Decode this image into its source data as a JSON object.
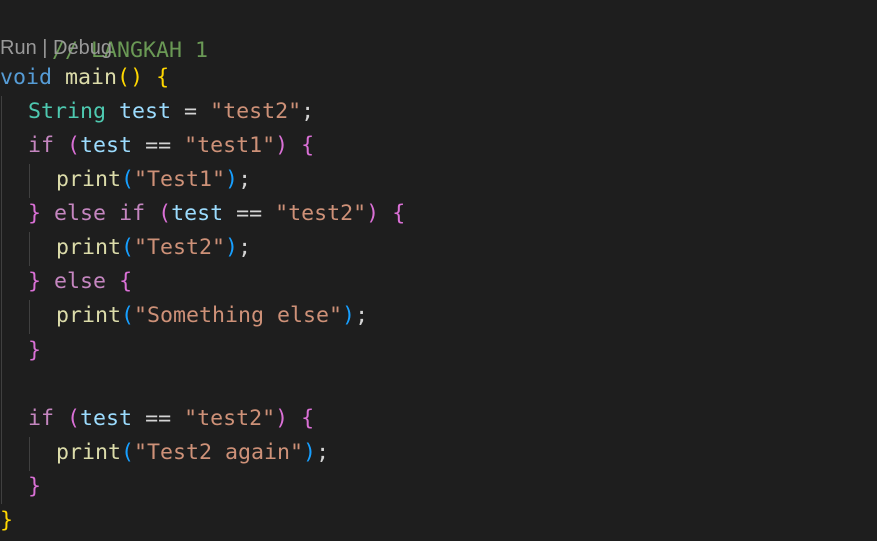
{
  "editor": {
    "comment": "// LANGKAH 1",
    "codelens": {
      "run": "Run",
      "separator": " | ",
      "debug": "Debug"
    },
    "tokens": {
      "void": "void",
      "main": "main",
      "paren_open": "(",
      "paren_close": ")",
      "brace_open": "{",
      "brace_close": "}",
      "String": "String",
      "test": "test",
      "assign": " = ",
      "eq": " == ",
      "if": "if",
      "else": "else",
      "print": "print",
      "semicolon": ";",
      "space": " "
    },
    "strings": {
      "test2": "\"test2\"",
      "test1": "\"test1\"",
      "Test1": "\"Test1\"",
      "Test2": "\"Test2\"",
      "something_else": "\"Something else\"",
      "test2_again": "\"Test2 again\""
    }
  },
  "colors": {
    "background": "#1e1e1e",
    "comment": "#6a9955",
    "keyword": "#569cd6",
    "control": "#c586c0",
    "type": "#4ec9b0",
    "variable": "#9cdcfe",
    "function": "#dcdcaa",
    "string": "#ce9178",
    "bracket_level1": "#ffd700",
    "bracket_level2": "#da70d6",
    "bracket_level3": "#179fff"
  }
}
